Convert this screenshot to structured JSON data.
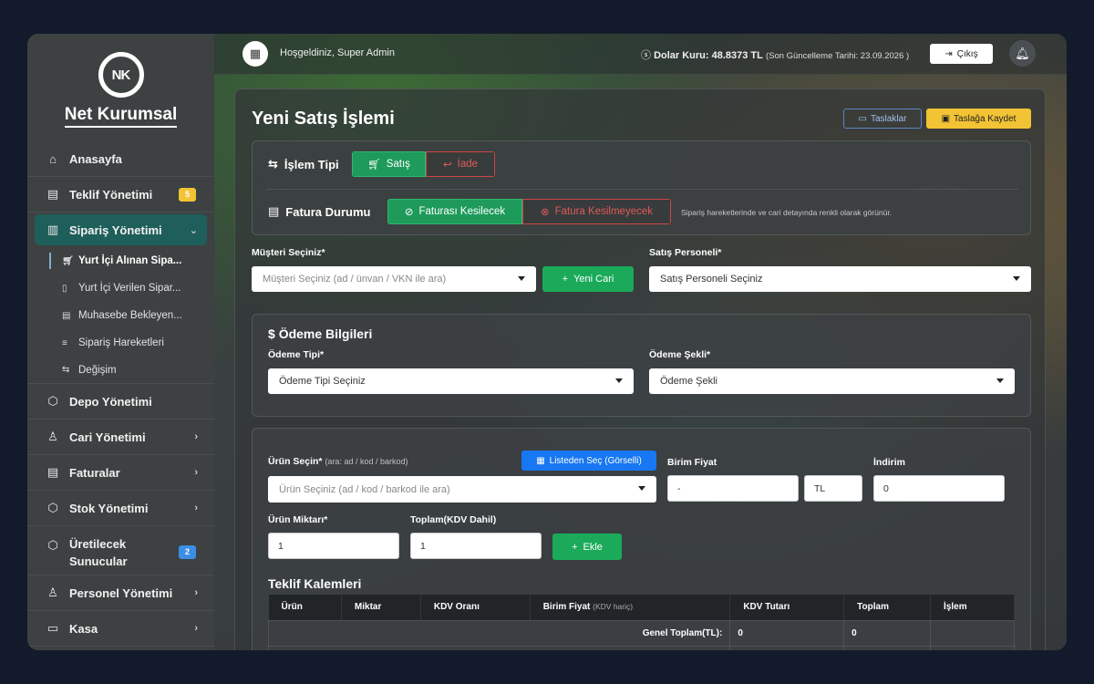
{
  "brand": {
    "name": "Net Kurumsal",
    "mark": "NK"
  },
  "sidebar": {
    "items": [
      {
        "label": "Anasayfa",
        "icon": "home-icon"
      },
      {
        "label": "Teklif Yönetimi",
        "icon": "document-icon",
        "badge": "5",
        "badge_color": "#f2c335"
      },
      {
        "label": "Sipariş Yönetimi",
        "icon": "clipboard-icon",
        "active": true
      },
      {
        "label": "Depo Yönetimi",
        "icon": "box-icon"
      },
      {
        "label": "Cari Yönetimi",
        "icon": "user-icon"
      },
      {
        "label": "Faturalar",
        "icon": "invoice-icon"
      },
      {
        "label": "Stok Yönetimi",
        "icon": "box-icon"
      },
      {
        "label": "Üretilecek Sunucular",
        "icon": "box-icon",
        "badge": "2",
        "badge_color": "#3a8ee6"
      },
      {
        "label": "Personel Yönetimi",
        "icon": "users-icon"
      },
      {
        "label": "Kasa",
        "icon": "cashbox-icon"
      }
    ],
    "sub_items": [
      {
        "label": "Yurt İçi Alınan Sipa..."
      },
      {
        "label": "Yurt İçi Verilen Sipar..."
      },
      {
        "label": "Muhasebe Bekleyen..."
      },
      {
        "label": "Sipariş Hareketleri"
      },
      {
        "label": "Değişim"
      }
    ]
  },
  "topbar": {
    "welcome": "Hoşgeldiniz, Super Admin",
    "dollar_label": "Dolar Kuru: 48.8373 TL",
    "dollar_note": "(Son Güncelleme Tarihi: 23.09.2026 )",
    "logout": "Çıkış"
  },
  "page": {
    "title": "Yeni Satış İşlemi",
    "drafts_button": "Taslaklar",
    "save_draft_button": "Taslağa Kaydet"
  },
  "transaction": {
    "type_label": "İşlem Tipi",
    "type_options": [
      "Satış",
      "İade"
    ],
    "invoice_label": "Fatura Durumu",
    "invoice_options": [
      "Faturası Kesilecek",
      "Fatura Kesilmeyecek"
    ],
    "invoice_hint": "Sipariş hareketlerinde ve cari detayında renkli olarak görünür."
  },
  "customer": {
    "label": "Müşteri Seçiniz*",
    "placeholder": "Müşteri Seçiniz (ad / ünvan / VKN ile ara)",
    "new_button": "Yeni Cari",
    "staff_label": "Satış Personeli*",
    "staff_value": "Satış Personeli Seçiniz"
  },
  "payment": {
    "title": "Ödeme Bilgileri",
    "type_label": "Ödeme Tipi*",
    "type_value": "Ödeme Tipi Seçiniz",
    "method_label": "Ödeme Şekli*",
    "method_value": "Ödeme Şekli"
  },
  "product": {
    "label": "Ürün Seçin*",
    "label_hint": "(ara: ad / kod / barkod)",
    "list_button": "Listeden Seç (Görselli)",
    "placeholder": "Ürün Seçiniz (ad / kod / barkod ile ara)",
    "unit_price_label": "Birim Fiyat",
    "unit_price_value": "-",
    "currency": "TL",
    "discount_label": "İndirim",
    "discount_value": "0",
    "qty_label": "Ürün Miktarı*",
    "qty_value": "1",
    "total_label": "Toplam(KDV Dahil)",
    "total_value": "1",
    "add_button": "Ekle"
  },
  "items_table": {
    "title": "Teklif Kalemleri",
    "headers": [
      "Ürün",
      "Miktar",
      "KDV Oranı",
      "Birim Fiyat",
      "KDV Tutarı",
      "Toplam",
      "İşlem"
    ],
    "unit_price_hint": "(KDV hariç)",
    "grand_total_label": "Genel Toplam(TL):",
    "grand_kdv": "0",
    "grand_total": "0"
  }
}
